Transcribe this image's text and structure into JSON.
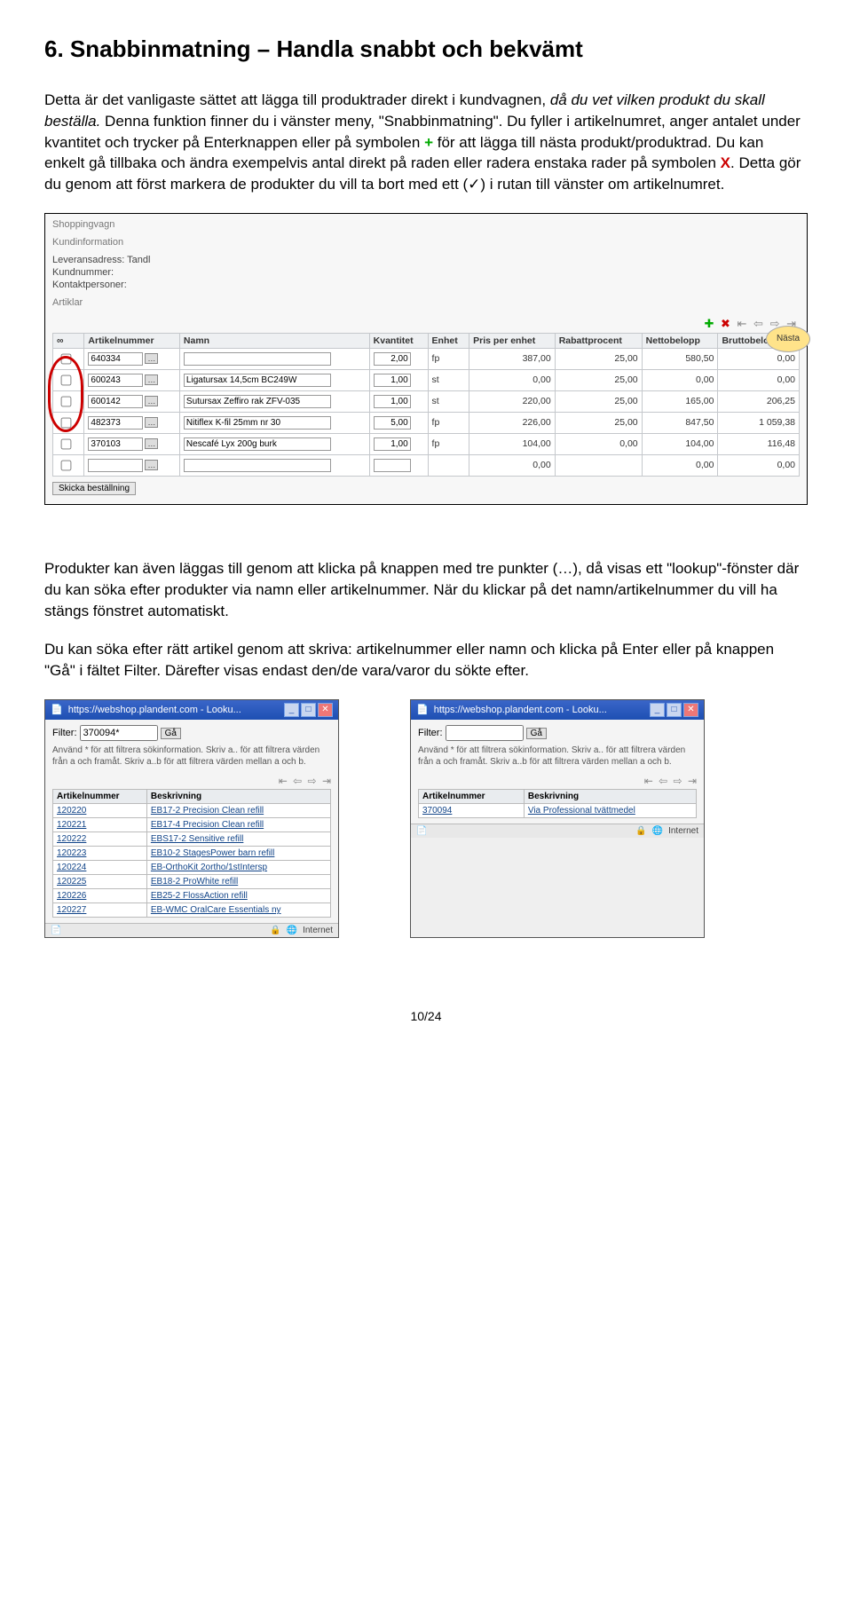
{
  "heading": "6. Snabbinmatning – Handla snabbt och bekvämt",
  "para1_a": "Detta är det vanligaste sättet att lägga till produktrader direkt i kundvagnen, ",
  "para1_i": "då du vet vilken produkt du skall beställa.",
  "para1_b": " Denna funktion finner du i vänster meny, \"Snabbinmatning\". Du fyller i artikelnumret, anger antalet under kvantitet och trycker på Enterknappen eller på symbolen ",
  "plus": "+",
  "para1_c": " för att lägga till nästa produkt/produktrad. Du kan enkelt gå tillbaka och ändra exempelvis antal direkt på raden eller radera enstaka rader på symbolen ",
  "x": "X",
  "para1_d": ". Detta gör du genom att först markera de produkter du vill ta bort med ett (✓) i rutan till vänster om artikelnumret.",
  "cart": {
    "title": "Shoppingvagn",
    "info_heading": "Kundinformation",
    "info_addr": "Leveransadress:  Tandl",
    "info_cust": "Kundnummer:",
    "info_contact": "Kontaktpersoner:",
    "info_articles": "Artiklar",
    "next_bubble": "Nästa",
    "headers": {
      "chk": "∞",
      "art": "Artikelnummer",
      "name": "Namn",
      "qty": "Kvantitet",
      "unit": "Enhet",
      "price": "Pris per enhet",
      "discount": "Rabattprocent",
      "net": "Nettobelopp",
      "gross": "Bruttobelopp"
    },
    "rows": [
      {
        "art": "640334",
        "name": "",
        "qty": "2,00",
        "unit": "fp",
        "price": "387,00",
        "disc": "25,00",
        "net": "580,50",
        "gross": "0,00"
      },
      {
        "art": "600243",
        "name": "Ligatursax 14,5cm BC249W",
        "qty": "1,00",
        "unit": "st",
        "price": "0,00",
        "disc": "25,00",
        "net": "0,00",
        "gross": "0,00"
      },
      {
        "art": "600142",
        "name": "Sutursax Zeffiro rak ZFV-035",
        "qty": "1,00",
        "unit": "st",
        "price": "220,00",
        "disc": "25,00",
        "net": "165,00",
        "gross": "206,25"
      },
      {
        "art": "482373",
        "name": "Nitiflex K-fil 25mm nr 30",
        "qty": "5,00",
        "unit": "fp",
        "price": "226,00",
        "disc": "25,00",
        "net": "847,50",
        "gross": "1 059,38"
      },
      {
        "art": "370103",
        "name": "Nescafé Lyx 200g burk",
        "qty": "1,00",
        "unit": "fp",
        "price": "104,00",
        "disc": "0,00",
        "net": "104,00",
        "gross": "116,48"
      },
      {
        "art": "",
        "name": "",
        "qty": "",
        "unit": "",
        "price": "0,00",
        "disc": "",
        "net": "0,00",
        "gross": "0,00"
      }
    ],
    "send": "Skicka beställning"
  },
  "para2": "Produkter kan även läggas till genom att klicka på knappen med tre punkter (…), då visas ett \"lookup\"-fönster där du kan söka efter produkter via namn eller artikelnummer. När du klickar på det namn/artikelnummer du vill ha stängs fönstret automatiskt.",
  "para3": "Du kan söka efter rätt artikel genom att skriva: artikelnummer eller namn och klicka på Enter eller på knappen \"Gå\" i fältet Filter. Därefter visas endast den/de vara/varor du sökte efter.",
  "popup_shared": {
    "title": "https://webshop.plandent.com - Looku...",
    "filter_label": "Filter:",
    "go": "Gå",
    "help": "Använd * för att filtrera sökinformation. Skriv a.. för att filtrera värden från a och framåt. Skriv a..b för att filtrera värden mellan a och b.",
    "col_art": "Artikelnummer",
    "col_desc": "Beskrivning",
    "status": "Internet"
  },
  "popup1": {
    "filter_value": "370094*",
    "rows": [
      {
        "art": "120220",
        "desc": "EB17-2 Precision Clean refill"
      },
      {
        "art": "120221",
        "desc": "EB17-4 Precision Clean refill"
      },
      {
        "art": "120222",
        "desc": "EBS17-2 Sensitive refill"
      },
      {
        "art": "120223",
        "desc": "EB10-2 StagesPower barn refill"
      },
      {
        "art": "120224",
        "desc": "EB-OrthoKit 2ortho/1stIntersp"
      },
      {
        "art": "120225",
        "desc": "EB18-2 ProWhite refill"
      },
      {
        "art": "120226",
        "desc": "EB25-2 FlossAction refill"
      },
      {
        "art": "120227",
        "desc": "EB-WMC OralCare Essentials ny"
      }
    ]
  },
  "popup2": {
    "filter_value": "",
    "rows": [
      {
        "art": "370094",
        "desc": "Via Professional tvättmedel"
      }
    ]
  },
  "pageno": "10/24"
}
